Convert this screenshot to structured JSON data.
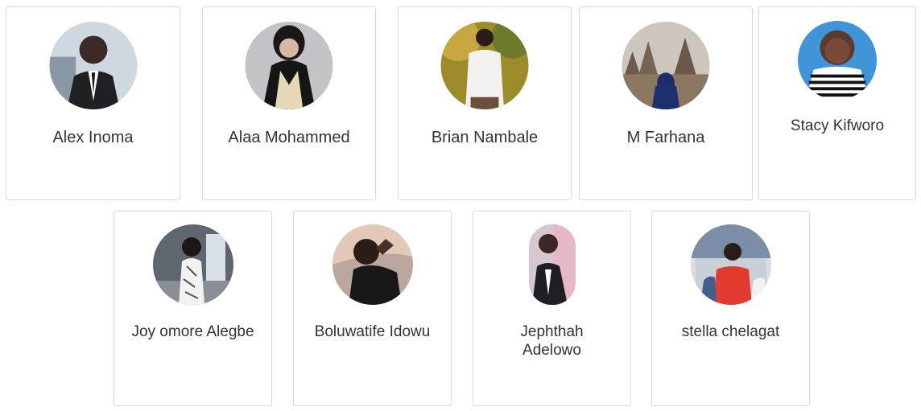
{
  "members": [
    {
      "name": "Alex Inoma",
      "image": "member-photo"
    },
    {
      "name": "Alaa Mohammed",
      "image": "member-photo"
    },
    {
      "name": "Brian Nambale",
      "image": "member-photo"
    },
    {
      "name": "M Farhana",
      "image": "member-photo"
    },
    {
      "name": "Stacy Kifworo",
      "image": "member-photo"
    },
    {
      "name": "Joy omore Alegbe",
      "image": "member-photo"
    },
    {
      "name": "Boluwatife Idowu",
      "image": "member-photo"
    },
    {
      "name": "Jephthah\nAdelowo",
      "image": "member-photo"
    },
    {
      "name": "stella chelagat",
      "image": "member-photo"
    }
  ],
  "colors": {
    "card_border": "#d9d9d9",
    "text": "#333333",
    "background": "#ffffff"
  }
}
